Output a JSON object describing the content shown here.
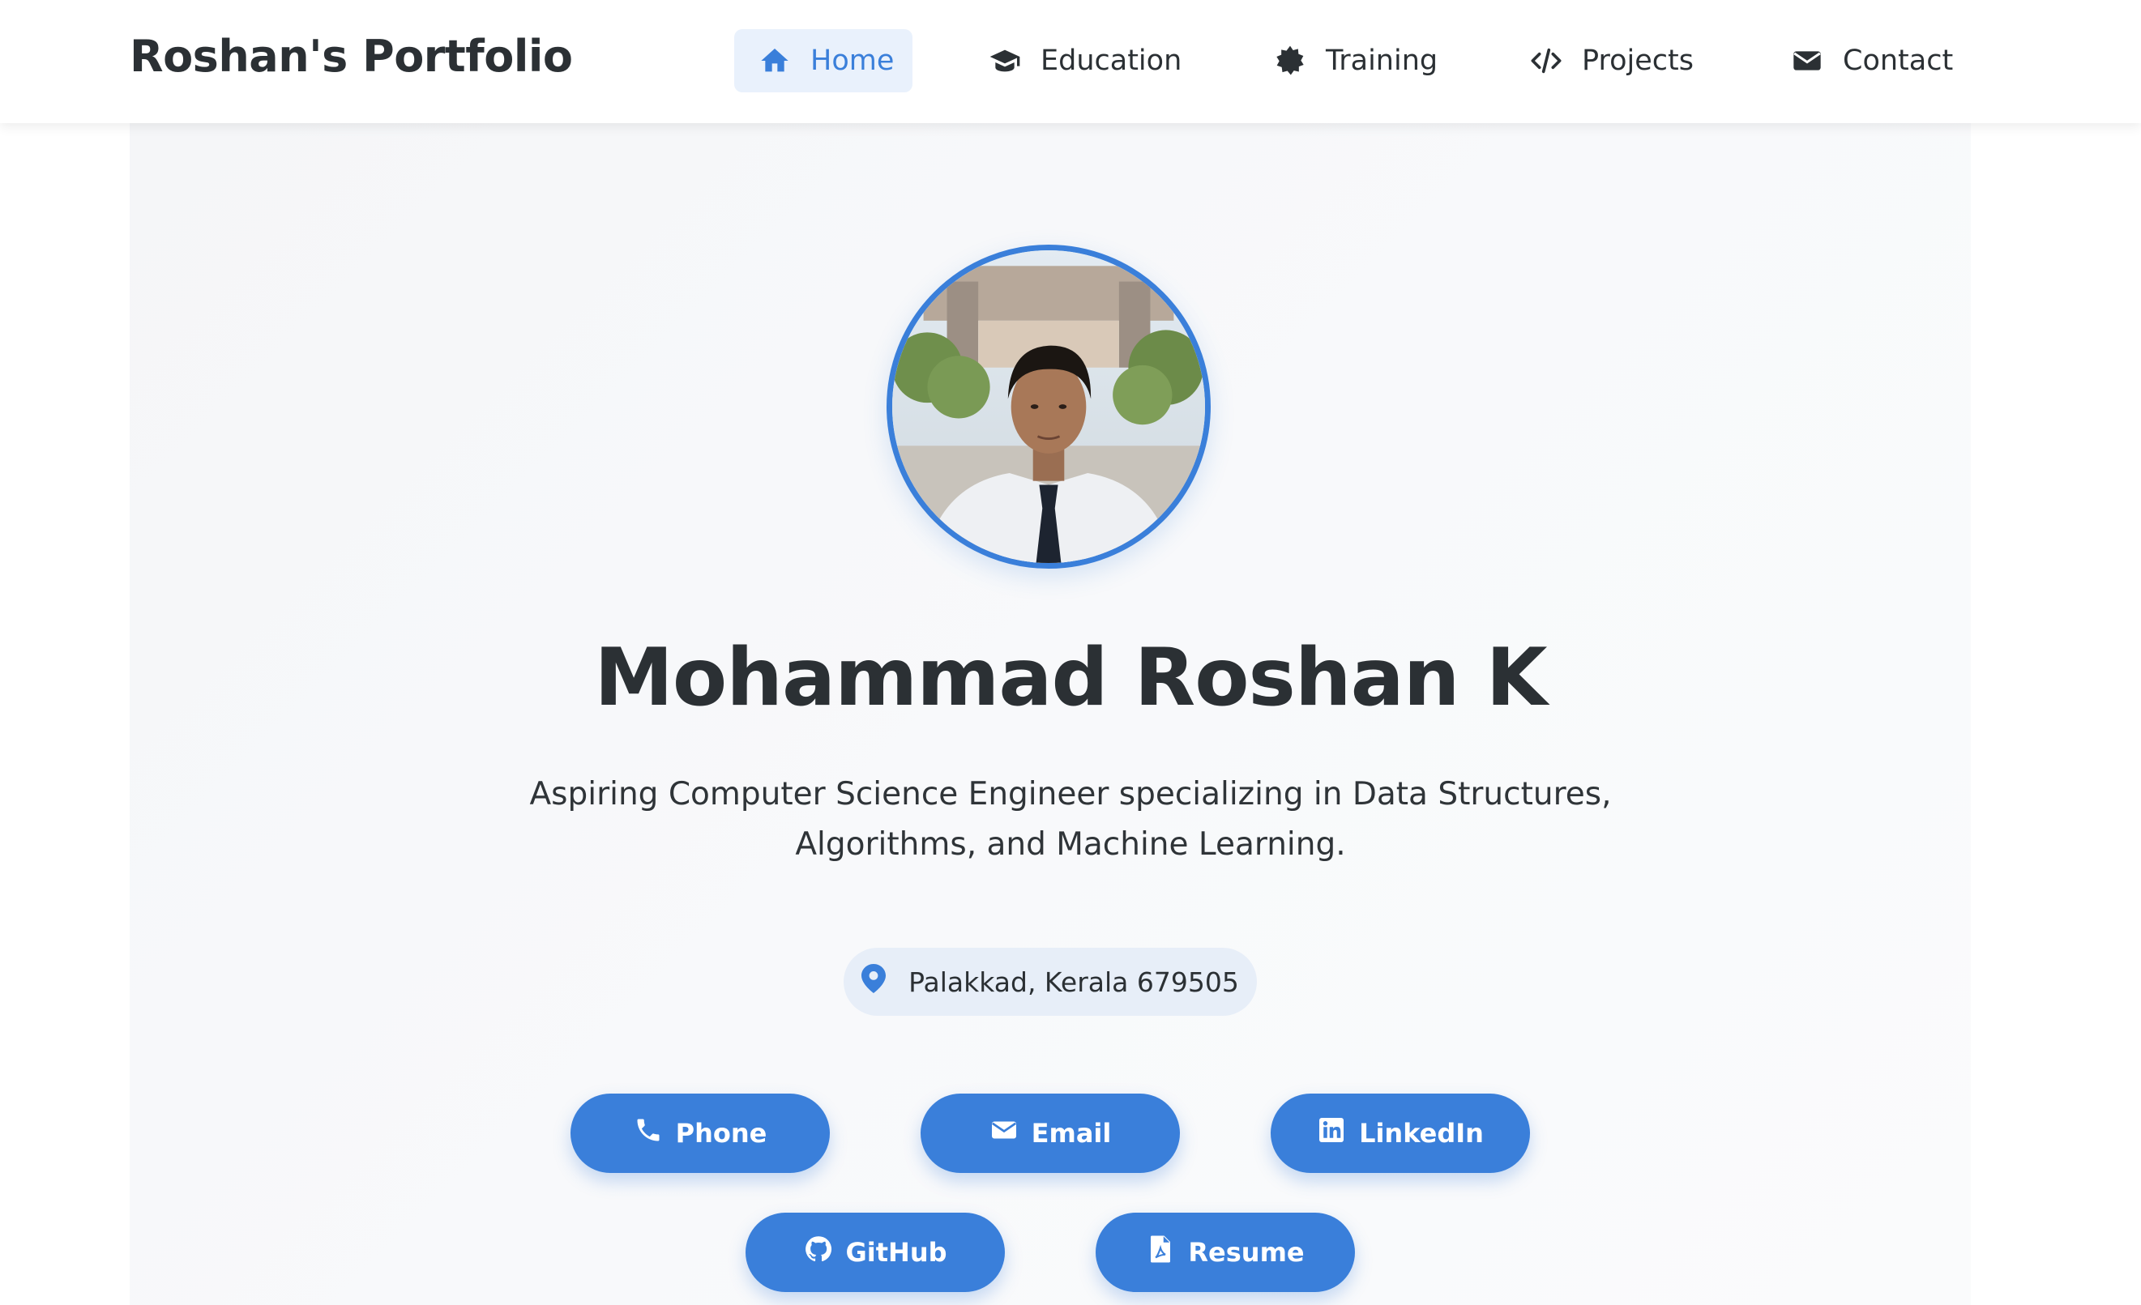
{
  "nav": {
    "brand": "Roshan's Portfolio",
    "items": [
      {
        "label": "Home",
        "icon": "home-icon",
        "active": true
      },
      {
        "label": "Education",
        "icon": "graduation-cap-icon",
        "active": false
      },
      {
        "label": "Training",
        "icon": "certificate-icon",
        "active": false
      },
      {
        "label": "Projects",
        "icon": "code-icon",
        "active": false
      },
      {
        "label": "Contact",
        "icon": "envelope-icon",
        "active": false
      }
    ]
  },
  "hero": {
    "name": "Mohammad Roshan K",
    "tagline": "Aspiring Computer Science Engineer specializing in Data Structures, Algorithms, and Machine Learning.",
    "location": "Palakkad, Kerala 679505",
    "buttons": [
      {
        "label": "Phone",
        "icon": "phone-icon"
      },
      {
        "label": "Email",
        "icon": "envelope-icon"
      },
      {
        "label": "LinkedIn",
        "icon": "linkedin-icon"
      },
      {
        "label": "GitHub",
        "icon": "github-icon"
      },
      {
        "label": "Resume",
        "icon": "pdf-file-icon"
      }
    ]
  },
  "colors": {
    "accent": "#3a7fda",
    "accent_light": "#e9f1fc",
    "text": "#2b3034",
    "background": "#f7f8fa"
  }
}
